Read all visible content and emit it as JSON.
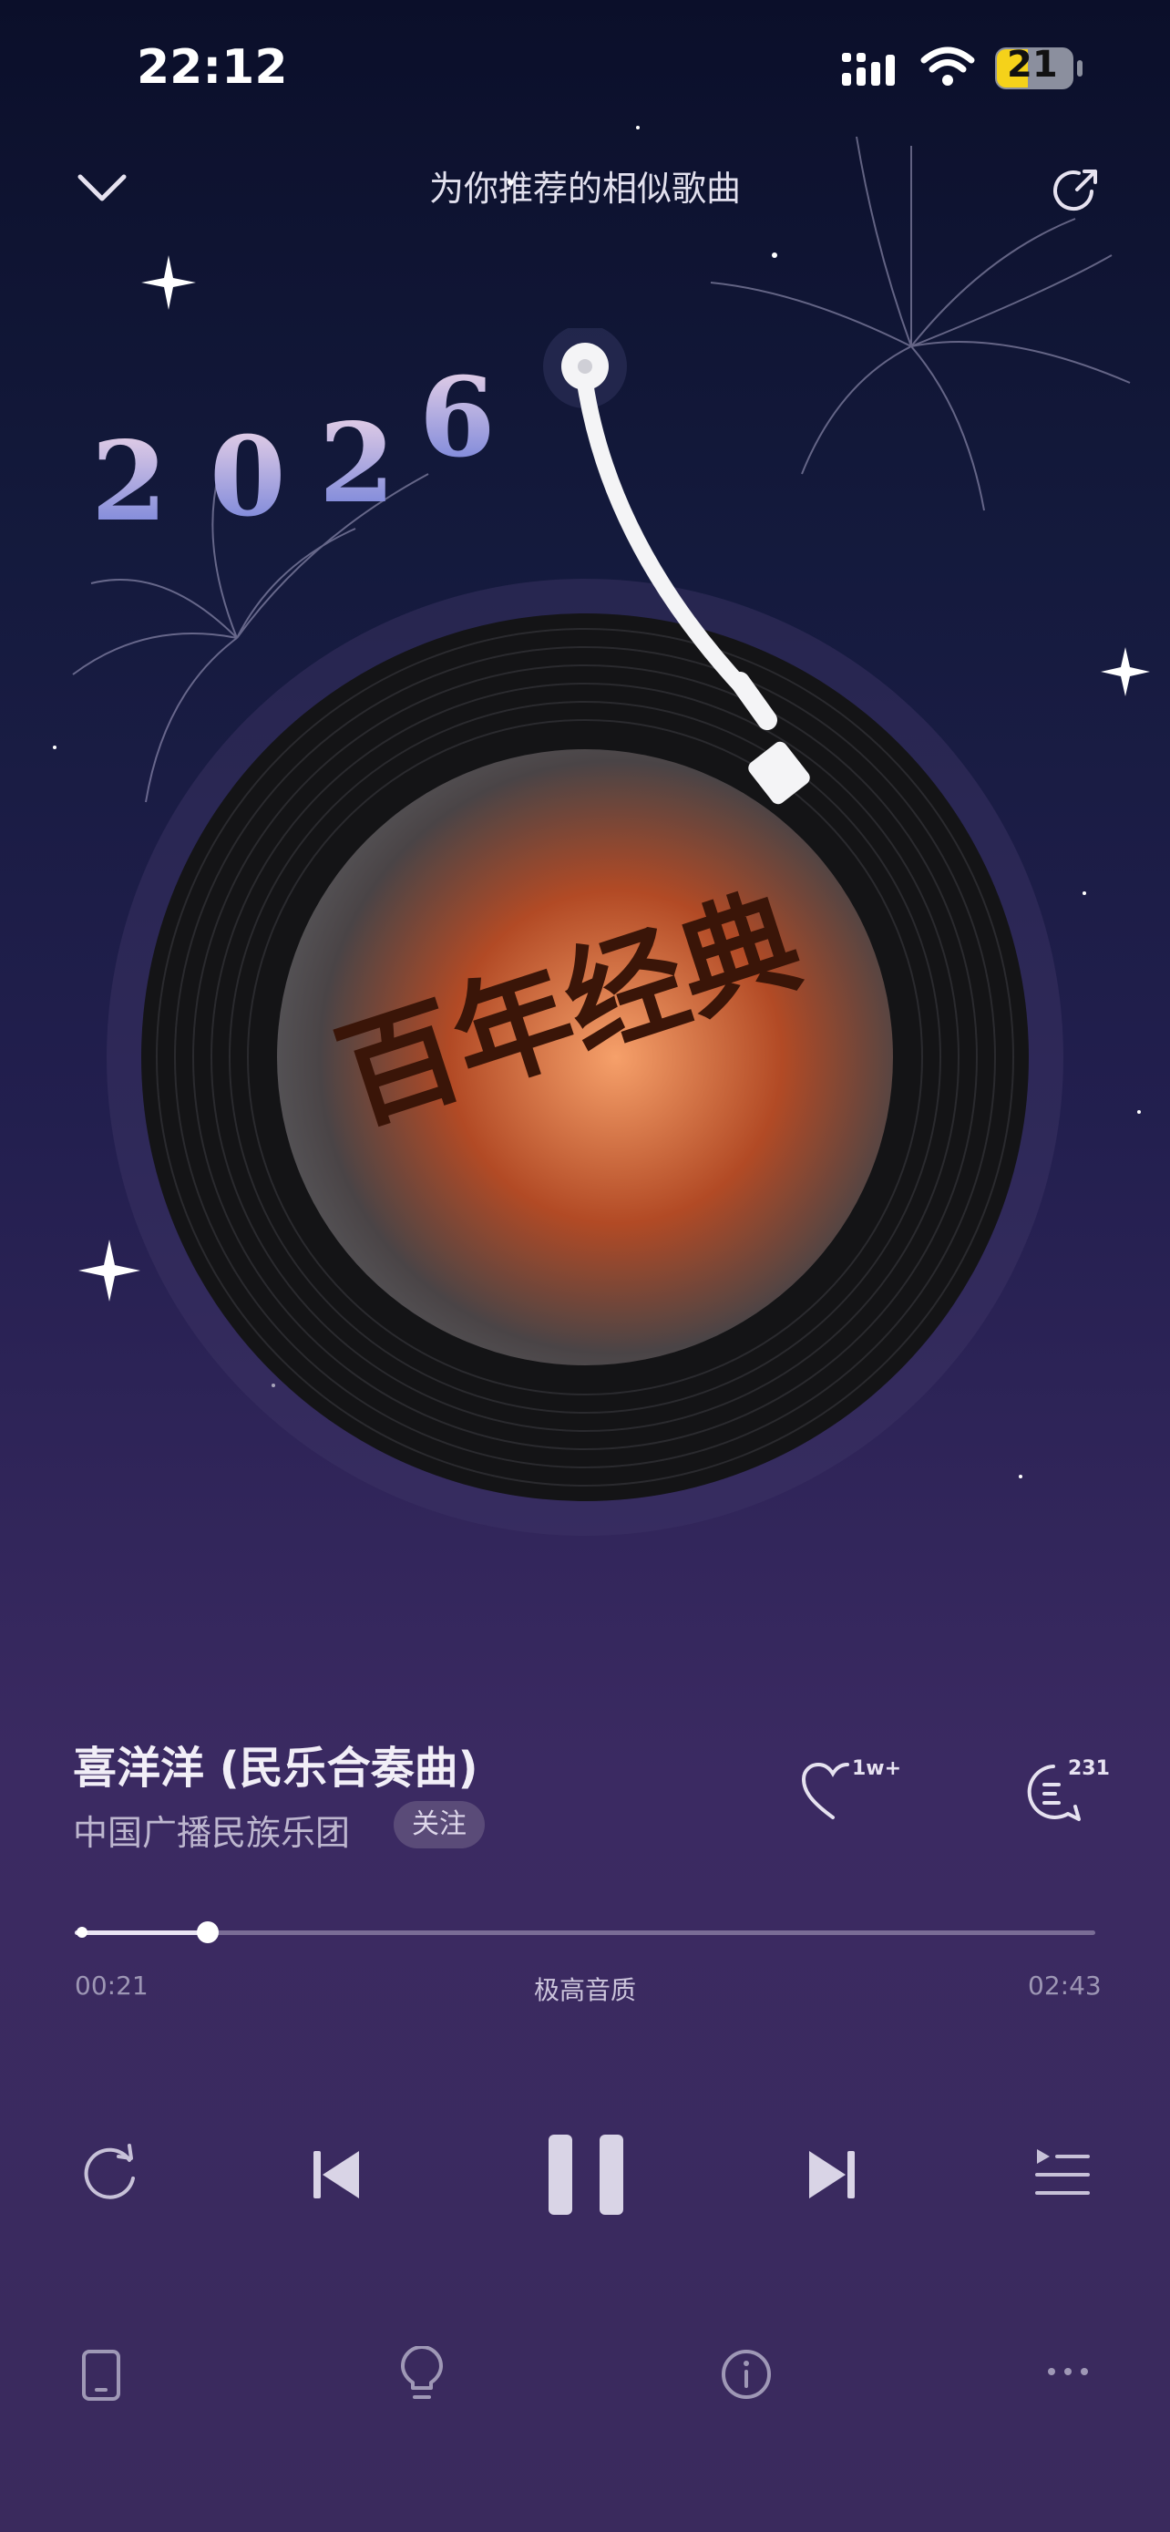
{
  "status": {
    "time": "22:12",
    "battery": "21"
  },
  "header": {
    "title": "为你推荐的相似歌曲"
  },
  "artwork": {
    "year": [
      "2",
      "0",
      "2",
      "6"
    ],
    "album_text": "百年经典"
  },
  "song": {
    "title": "喜洋洋 (民乐合奏曲)",
    "artist": "中国广播民族乐团",
    "follow_label": "关注"
  },
  "actions": {
    "like_count": "1w+",
    "comment_count": "231"
  },
  "progress": {
    "current": "00:21",
    "total": "02:43",
    "quality": "极高音质",
    "fraction": 0.13
  },
  "colors": {
    "accent": "#e9e4f3",
    "battery": "#f5d21a"
  }
}
